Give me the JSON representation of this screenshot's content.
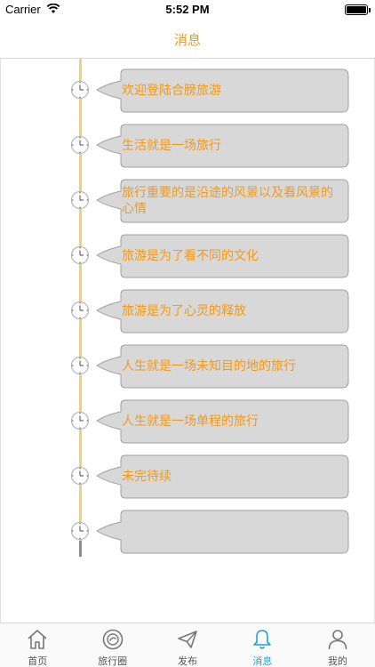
{
  "status_bar": {
    "carrier": "Carrier",
    "time": "5:52 PM"
  },
  "nav": {
    "title": "消息"
  },
  "messages": [
    {
      "text": "欢迎登陆合膀旅游"
    },
    {
      "text": "生活就是一场旅行"
    },
    {
      "text": "旅行重要的是沿途的风景以及看风景的心情"
    },
    {
      "text": "旅游是为了看不同的文化"
    },
    {
      "text": "旅游是为了心灵的释放"
    },
    {
      "text": "人生就是一场未知目的地的旅行"
    },
    {
      "text": "人生就是一场单程的旅行"
    },
    {
      "text": "未完待续"
    },
    {
      "text": ""
    }
  ],
  "tabs": [
    {
      "label": "首页",
      "icon": "home-icon"
    },
    {
      "label": "旅行圈",
      "icon": "circle-icon"
    },
    {
      "label": "发布",
      "icon": "paper-plane-icon"
    },
    {
      "label": "消息",
      "icon": "bell-icon"
    },
    {
      "label": "我的",
      "icon": "person-icon"
    }
  ],
  "colors": {
    "accent": "#f39a1b",
    "active_tab": "#1aa3de",
    "timeline": "#f8cf6b",
    "bubble_fill": "#d8d8d8"
  }
}
